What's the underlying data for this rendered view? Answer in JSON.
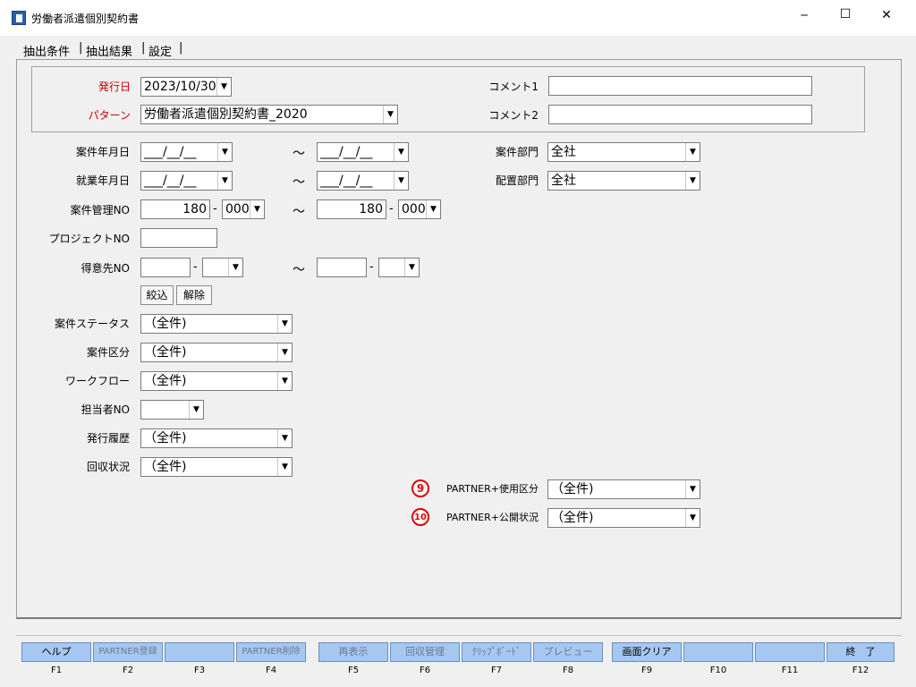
{
  "window": {
    "title": "労働者派遣個別契約書",
    "minimize": "─",
    "maximize": "☐",
    "close": "✕"
  },
  "tabs": [
    "抽出条件",
    "抽出結果",
    "設定"
  ],
  "header": {
    "issue_date_label": "発行日",
    "issue_date_value": "2023/10/30",
    "pattern_label": "パターン",
    "pattern_value": "労働者派遣個別契約書_2020",
    "comment1_label": "コメント1",
    "comment2_label": "コメント2"
  },
  "form": {
    "case_date_label": "案件年月日",
    "work_date_label": "就業年月日",
    "case_no_label": "案件管理NO",
    "project_no_label": "プロジェクトNO",
    "customer_no_label": "得意先NO",
    "date_placeholder": "___/__/__",
    "case_no_from": "180",
    "case_no_to": "180",
    "case_no_sub": "000",
    "tilde": "～",
    "dash": "-",
    "case_dept_label": "案件部門",
    "case_dept_value": "全社",
    "place_dept_label": "配置部門",
    "place_dept_value": "全社",
    "filter_button": "絞込",
    "clear_button": "解除",
    "case_status_label": "案件ステータス",
    "case_type_label": "案件区分",
    "workflow_label": "ワークフロー",
    "staff_no_label": "担当者NO",
    "issue_history_label": "発行履歴",
    "collection_label": "回収状況",
    "all_value": "（全件)",
    "partner_use_badge": "9",
    "partner_use_label": "PARTNER+使用区分",
    "partner_pub_badge": "10",
    "partner_pub_label": "PARTNER+公開状況"
  },
  "fkeys": [
    {
      "label": "ヘルプ",
      "num": "F1"
    },
    {
      "label": "PARTNER登録",
      "num": "F2"
    },
    {
      "label": "",
      "num": "F3"
    },
    {
      "label": "PARTNER削除",
      "num": "F4"
    },
    {
      "label": "再表示",
      "num": "F5"
    },
    {
      "label": "回収管理",
      "num": "F6"
    },
    {
      "label": "ｸﾘｯﾌﾟﾎﾞｰﾄﾞ",
      "num": "F7"
    },
    {
      "label": "プレビュー",
      "num": "F8"
    },
    {
      "label": "画面クリア",
      "num": "F9"
    },
    {
      "label": "",
      "num": "F10"
    },
    {
      "label": "",
      "num": "F11"
    },
    {
      "label": "終　了",
      "num": "F12"
    }
  ],
  "colors": {
    "accent_red": "#cc0000",
    "fkey_bg": "#a6c8f0",
    "badge_red": "#e00000"
  }
}
